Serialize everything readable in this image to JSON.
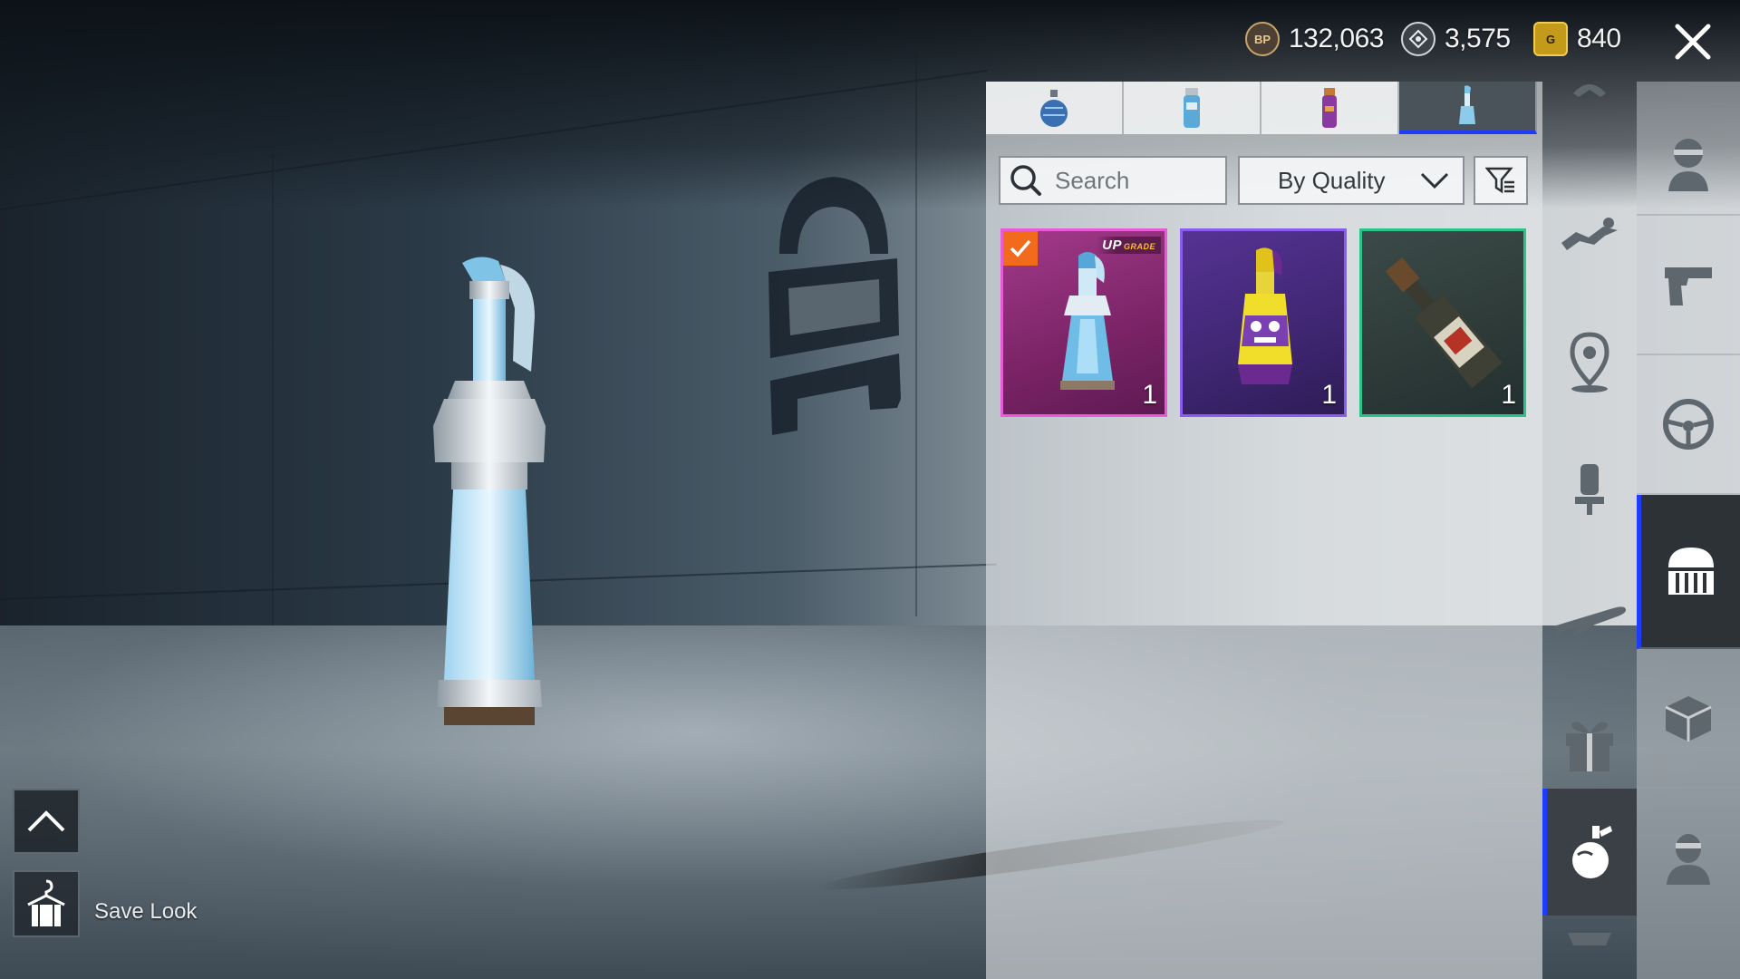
{
  "currency": {
    "bp": {
      "icon": "bp-coin-icon",
      "badge": "BP",
      "value": "132,063"
    },
    "silver": {
      "icon": "silver-fragment-icon",
      "value": "3,575"
    },
    "gold": {
      "icon": "g-coin-icon",
      "badge": "G",
      "value": "840"
    }
  },
  "tabs": [
    {
      "icon": "frag-grenade-skin-icon",
      "active": false
    },
    {
      "icon": "smoke-grenade-skin-icon",
      "active": false
    },
    {
      "icon": "stun-grenade-skin-icon",
      "active": false
    },
    {
      "icon": "molotov-skin-icon",
      "active": true
    }
  ],
  "toolbar": {
    "search_placeholder": "Search",
    "sort_label": "By Quality"
  },
  "items": [
    {
      "quality": "legendary",
      "count": "1",
      "equipped": true,
      "badge_prefix": "UP",
      "badge_suffix": "GRADE"
    },
    {
      "quality": "epic",
      "count": "1",
      "equipped": false
    },
    {
      "quality": "common",
      "count": "1",
      "equipped": false
    }
  ],
  "colors": {
    "accent": "#1e3cff",
    "equipped": "#f26b1d",
    "legendary_border": "#e85ad6",
    "epic_border": "#8a5cf0",
    "common_border": "#27c589"
  },
  "rail_a": [
    "parachute-top-icon",
    "skydive-icon",
    "location-pin-icon",
    "seat-icon",
    "airplane-icon",
    "gift-box-icon",
    "grenade-icon"
  ],
  "rail_b": [
    "character-icon",
    "pistol-icon",
    "steering-wheel-icon",
    "helmet-logo-icon",
    "crate-icon",
    "avatar-icon"
  ],
  "bottom": {
    "save_label": "Save Look"
  }
}
